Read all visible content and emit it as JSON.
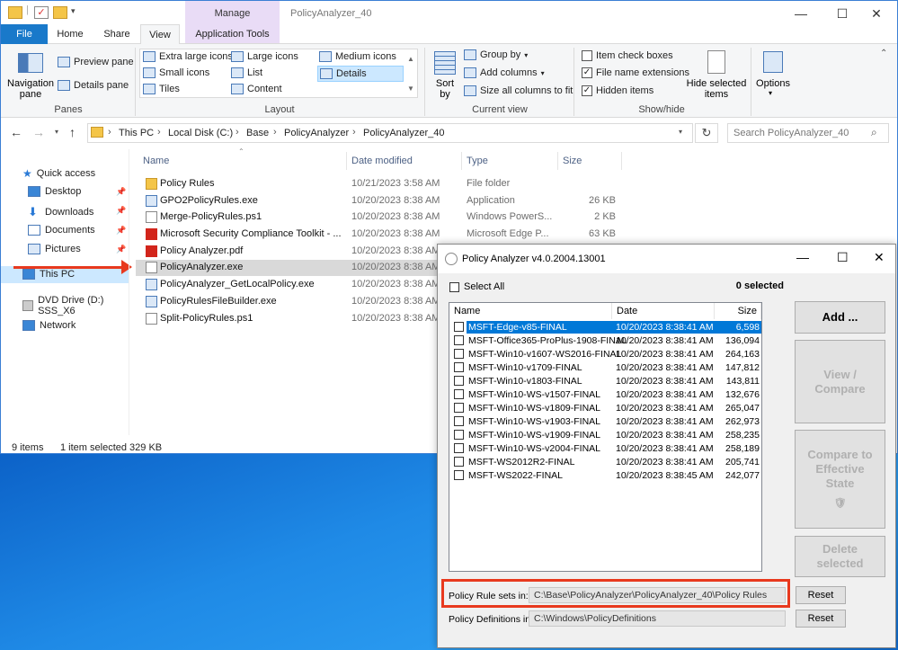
{
  "window": {
    "title": "PolicyAnalyzer_40",
    "manage_tab": "Manage"
  },
  "ribbon": {
    "tabs": [
      "File",
      "Home",
      "Share",
      "View",
      "Application Tools"
    ],
    "panes": {
      "navigation_pane": "Navigation pane",
      "preview_pane": "Preview pane",
      "details_pane": "Details pane",
      "label": "Panes"
    },
    "layout": {
      "items": [
        "Extra large icons",
        "Large icons",
        "Medium icons",
        "Small icons",
        "List",
        "Details",
        "Tiles",
        "Content"
      ],
      "label": "Layout"
    },
    "current_view": {
      "sort_by": "Sort by",
      "group_by": "Group by",
      "add_columns": "Add columns",
      "size_all": "Size all columns to fit",
      "label": "Current view"
    },
    "show_hide": {
      "item_check_boxes": "Item check boxes",
      "file_name_extensions": "File name extensions",
      "hidden_items": "Hidden items",
      "hide_selected": "Hide selected items",
      "label": "Show/hide"
    },
    "options": "Options"
  },
  "address": {
    "crumbs": [
      "This PC",
      "Local Disk (C:)",
      "Base",
      "PolicyAnalyzer",
      "PolicyAnalyzer_40"
    ],
    "search_placeholder": "Search PolicyAnalyzer_40"
  },
  "nav": {
    "quick_access": "Quick access",
    "desktop": "Desktop",
    "downloads": "Downloads",
    "documents": "Documents",
    "pictures": "Pictures",
    "this_pc": "This PC",
    "dvd": "DVD Drive (D:) SSS_X6",
    "network": "Network"
  },
  "columns": {
    "name": "Name",
    "date": "Date modified",
    "type": "Type",
    "size": "Size"
  },
  "files": [
    {
      "name": "Policy Rules",
      "date": "10/21/2023 3:58 AM",
      "type": "File folder",
      "size": ""
    },
    {
      "name": "GPO2PolicyRules.exe",
      "date": "10/20/2023 8:38 AM",
      "type": "Application",
      "size": "26 KB"
    },
    {
      "name": "Merge-PolicyRules.ps1",
      "date": "10/20/2023 8:38 AM",
      "type": "Windows PowerS...",
      "size": "2 KB"
    },
    {
      "name": "Microsoft Security Compliance Toolkit - ...",
      "date": "10/20/2023 8:38 AM",
      "type": "Microsoft Edge P...",
      "size": "63 KB"
    },
    {
      "name": "Policy Analyzer.pdf",
      "date": "10/20/2023 8:38 AM",
      "type": "",
      "size": ""
    },
    {
      "name": "PolicyAnalyzer.exe",
      "date": "10/20/2023 8:38 AM",
      "type": "",
      "size": ""
    },
    {
      "name": "PolicyAnalyzer_GetLocalPolicy.exe",
      "date": "10/20/2023 8:38 AM",
      "type": "",
      "size": ""
    },
    {
      "name": "PolicyRulesFileBuilder.exe",
      "date": "10/20/2023 8:38 AM",
      "type": "",
      "size": ""
    },
    {
      "name": "Split-PolicyRules.ps1",
      "date": "10/20/2023 8:38 AM",
      "type": "",
      "size": ""
    }
  ],
  "status": {
    "items": "9 items",
    "selected": "1 item selected  329 KB"
  },
  "dialog": {
    "title": "Policy Analyzer v4.0.2004.13001",
    "select_all": "Select All",
    "selected_count": "0 selected",
    "cols": {
      "name": "Name",
      "date": "Date",
      "size": "Size"
    },
    "rows": [
      {
        "name": "MSFT-Edge-v85-FINAL",
        "date": "10/20/2023 8:38:41 AM",
        "size": "6,598"
      },
      {
        "name": "MSFT-Office365-ProPlus-1908-FINAL",
        "date": "10/20/2023 8:38:41 AM",
        "size": "136,094"
      },
      {
        "name": "MSFT-Win10-v1607-WS2016-FINAL",
        "date": "10/20/2023 8:38:41 AM",
        "size": "264,163"
      },
      {
        "name": "MSFT-Win10-v1709-FINAL",
        "date": "10/20/2023 8:38:41 AM",
        "size": "147,812"
      },
      {
        "name": "MSFT-Win10-v1803-FINAL",
        "date": "10/20/2023 8:38:41 AM",
        "size": "143,811"
      },
      {
        "name": "MSFT-Win10-WS-v1507-FINAL",
        "date": "10/20/2023 8:38:41 AM",
        "size": "132,676"
      },
      {
        "name": "MSFT-Win10-WS-v1809-FINAL",
        "date": "10/20/2023 8:38:41 AM",
        "size": "265,047"
      },
      {
        "name": "MSFT-Win10-WS-v1903-FINAL",
        "date": "10/20/2023 8:38:41 AM",
        "size": "262,973"
      },
      {
        "name": "MSFT-Win10-WS-v1909-FINAL",
        "date": "10/20/2023 8:38:41 AM",
        "size": "258,235"
      },
      {
        "name": "MSFT-Win10-WS-v2004-FINAL",
        "date": "10/20/2023 8:38:41 AM",
        "size": "258,189"
      },
      {
        "name": "MSFT-WS2012R2-FINAL",
        "date": "10/20/2023 8:38:41 AM",
        "size": "205,741"
      },
      {
        "name": "MSFT-WS2022-FINAL",
        "date": "10/20/2023 8:38:45 AM",
        "size": "242,077"
      }
    ],
    "buttons": {
      "add": "Add ...",
      "view_line1": "View /",
      "view_line2": "Compare",
      "compare_line1": "Compare to",
      "compare_line2": "Effective",
      "compare_line3": "State",
      "delete_line1": "Delete",
      "delete_line2": "selected",
      "reset": "Reset"
    },
    "rule_sets_label": "Policy Rule sets in:",
    "rule_sets_path": "C:\\Base\\PolicyAnalyzer\\PolicyAnalyzer_40\\Policy Rules",
    "definitions_label": "Policy Definitions in:",
    "definitions_path": "C:\\Windows\\PolicyDefinitions"
  },
  "colors": {
    "accent": "#0078d7",
    "highlight": "#e8391e",
    "manage": "#e9dcf6"
  }
}
